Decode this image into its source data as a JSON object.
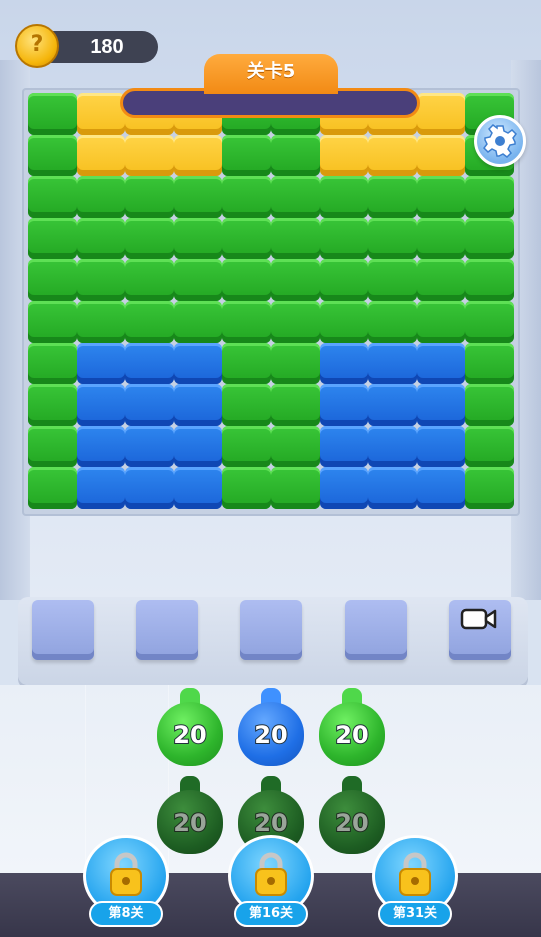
{
  "hud": {
    "coins": "180",
    "level_title": "关卡5",
    "level_progress": 0.0
  },
  "board": {
    "cols": 10,
    "rows": 10,
    "colors": {
      "G": "#2fb52e",
      "Y": "#f9c52a",
      "B": "#1f6ee0"
    },
    "grid": [
      "GYYYGGYYYG",
      "GYYYGGYYYG",
      "GGGGGGGGGG",
      "GGGGGGGGGG",
      "GGGGGGGGGG",
      "GGGGGGGGGG",
      "GBBBGGBBBG",
      "GBBBGGBBBG",
      "GBBBGGBBBG",
      "GBBBGGBBBG"
    ]
  },
  "slots": {
    "count": 5,
    "last_slot_icon": "video-camera-icon"
  },
  "bottles": {
    "front": [
      {
        "color": "green",
        "count": "20"
      },
      {
        "color": "blue",
        "count": "20"
      },
      {
        "color": "green",
        "count": "20"
      }
    ],
    "back": [
      {
        "color": "dark-green",
        "count": "20"
      },
      {
        "color": "dark-green",
        "count": "20"
      },
      {
        "color": "dark-green",
        "count": "20"
      }
    ]
  },
  "unlocks": [
    {
      "label": "第8关",
      "icon": "lock-icon"
    },
    {
      "label": "第16关",
      "icon": "lock-icon"
    },
    {
      "label": "第31关",
      "icon": "lock-icon"
    }
  ]
}
